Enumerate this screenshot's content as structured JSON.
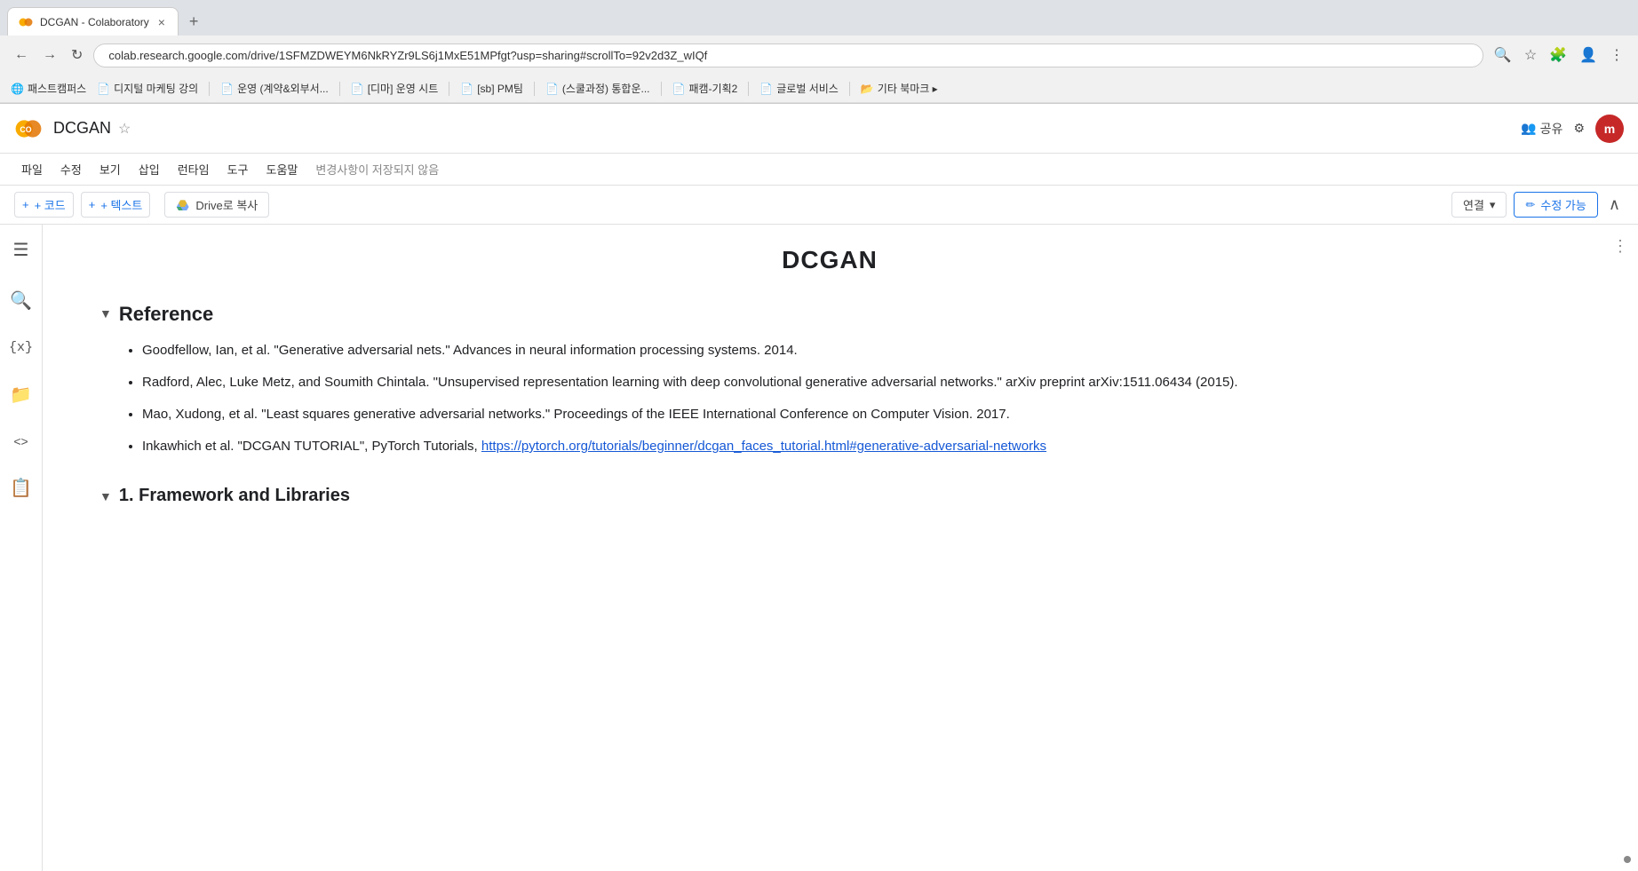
{
  "browser": {
    "tab_title": "DCGAN - Colaboratory",
    "tab_close": "×",
    "new_tab": "+",
    "address": "colab.research.google.com/drive/1SFMZDWEYM6NkRYZr9LS6j1MxE51MPfgt?usp=sharing#scrollTo=92v2d3Z_wIQf",
    "bookmarks": [
      {
        "label": "패스트캠퍼스",
        "icon": "🌐"
      },
      {
        "label": "디지털 마케팅 강의",
        "icon": "📄"
      },
      {
        "label": "운영 (계약&외부서...",
        "icon": "📄"
      },
      {
        "label": "[디마] 운영 시트",
        "icon": "📄"
      },
      {
        "label": "[sb] PM팀",
        "icon": "📄"
      },
      {
        "label": "(스쿨과정) 통합운...",
        "icon": "📄"
      },
      {
        "label": "패캠-기획2",
        "icon": "📄"
      },
      {
        "label": "글로벌 서비스",
        "icon": "📄"
      },
      {
        "label": "기타 북마크 ▸",
        "icon": "📂"
      }
    ]
  },
  "colab": {
    "logo_text": "CO",
    "title": "DCGAN",
    "unsaved_label": "변경사항이 저장되지 않음",
    "menu": {
      "items": [
        "파일",
        "수정",
        "보기",
        "삽입",
        "런타임",
        "도구",
        "도움말"
      ]
    },
    "toolbar": {
      "add_code": "+ 코드",
      "add_text": "+ 텍스트",
      "drive_copy": "Drive로 복사",
      "connect": "연결",
      "edit": "수정 가능"
    },
    "header_actions": {
      "share_icon": "👥",
      "share_label": "공유",
      "settings_icon": "⚙",
      "user_initials": "m"
    }
  },
  "document": {
    "title": "DCGAN",
    "sections": [
      {
        "id": "reference",
        "title": "Reference",
        "collapsed": false,
        "items": [
          {
            "text": "Goodfellow, Ian, et al. \"Generative adversarial nets.\" Advances in neural information processing systems. 2014.",
            "link": null
          },
          {
            "text": "Radford, Alec, Luke Metz, and Soumith Chintala. \"Unsupervised representation learning with deep convolutional generative adversarial networks.\" arXiv preprint arXiv:1511.06434 (2015).",
            "link": null
          },
          {
            "text": "Mao, Xudong, et al. \"Least squares generative adversarial networks.\" Proceedings of the IEEE International Conference on Computer Vision. 2017.",
            "link": null
          },
          {
            "text": "Inkawhich et al. \"DCGAN TUTORIAL\", PyTorch Tutorials, ",
            "link": "https://pytorch.org/tutorials/beginner/dcgan_faces_tutorial.html#generative-adversarial-networks",
            "link_text": "https://pytorch.org/tutorials/beginner/dcgan_faces_tutorial.html#generative-adversarial-networks"
          }
        ]
      },
      {
        "id": "framework",
        "title": "1. Framework and Libraries",
        "collapsed": false
      }
    ]
  },
  "sidebar": {
    "icons": [
      "☰",
      "🔍",
      "{x}",
      "📁",
      "<>",
      "📋"
    ]
  }
}
